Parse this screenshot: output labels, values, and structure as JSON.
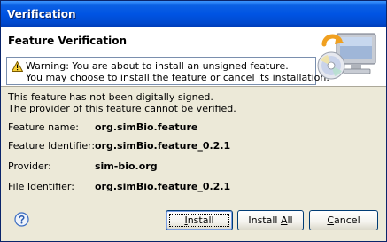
{
  "window": {
    "title": "Verification"
  },
  "header": {
    "title": "Feature Verification",
    "warning_line1": "Warning: You are about to install an unsigned feature.",
    "warning_line2": "You may choose to install the feature or cancel its installation."
  },
  "message": {
    "line1": "This feature has not been digitally signed.",
    "line2": "The provider of this feature cannot be verified."
  },
  "fields": [
    {
      "label": "Feature name:",
      "value": "org.simBio.feature"
    },
    {
      "label": "Feature Identifier:",
      "value": "org.simBio.feature_0.2.1"
    },
    {
      "label": "Provider:",
      "value": "sim-bio.org"
    },
    {
      "label": "File Identifier:",
      "value": "org.simBio.feature_0.2.1"
    }
  ],
  "buttons": {
    "install_mnemonic": "I",
    "install_rest": "nstall",
    "install_all_prefix": "Install ",
    "install_all_mnemonic": "A",
    "install_all_rest": "ll",
    "cancel_mnemonic": "C",
    "cancel_rest": "ancel"
  },
  "icons": {
    "help": "help-icon",
    "warning": "warning-icon",
    "header_art": "install-computer-cd-icon"
  }
}
